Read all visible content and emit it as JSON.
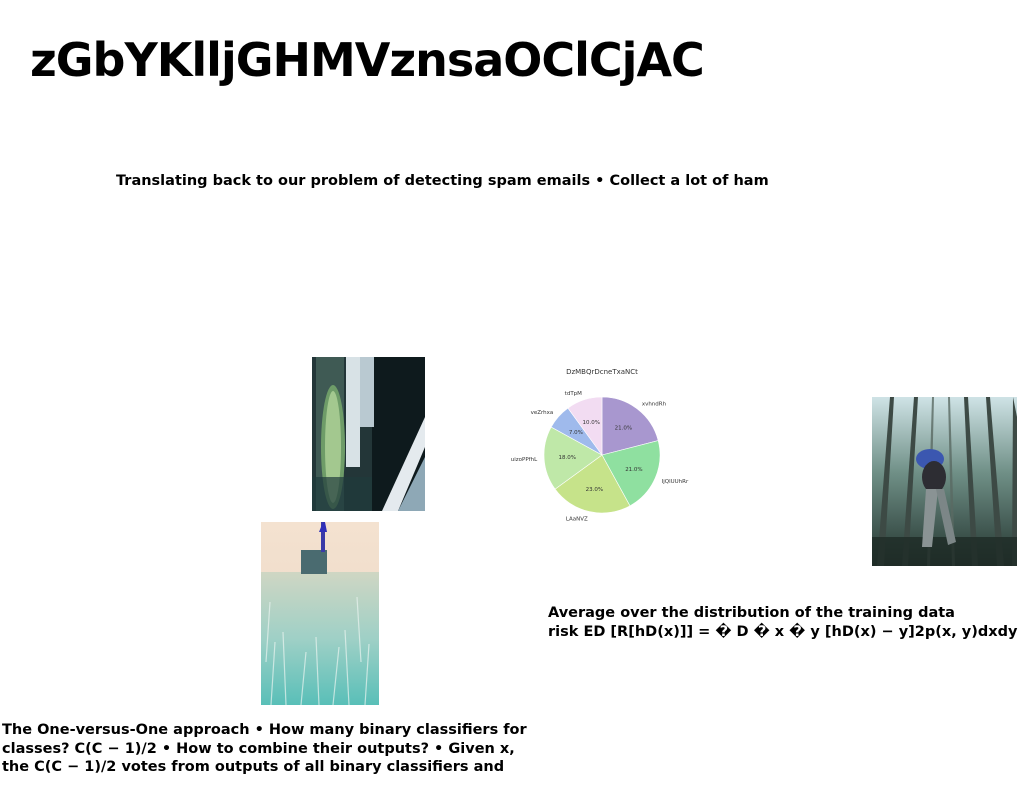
{
  "slide": {
    "title": "zGbYKlljGHMVznsaOClCjAC",
    "subtitle": "Translating back to our problem of detecting spam emails • Collect a lot of ham",
    "bottom_left_text": "The One-versus-One approach • How many binary classifiers for classes? C(C − 1)/2 • How to combine their outputs? • Given x, the C(C − 1)/2 votes from outputs of all binary classifiers and",
    "right_text_line1": "Average over the distribution of the training data",
    "right_text_line2": "risk ED [R[hD(x)]] = � D � x � y [hD(x) − y]2p(x, y)dxdy"
  },
  "chart_data": {
    "type": "pie",
    "title": "DzMBQrDcneTxaNCt",
    "labels": [
      "xvhndRh",
      "IjQlUUhRr",
      "LAaNVZ",
      "uizoPPfhL",
      "veZrhxa",
      "tdTpM"
    ],
    "values": [
      21.0,
      21.0,
      23.0,
      18.0,
      7.0,
      10.0
    ],
    "value_labels": [
      "21.0%",
      "21.0%",
      "23.0%",
      "18.0%",
      "7.0%",
      "10.0%"
    ],
    "colors": [
      "#a897cf",
      "#8fe0a0",
      "#c6e38a",
      "#bfe8a8",
      "#9fbaec",
      "#f2dcf2"
    ],
    "start_angle": 90,
    "direction": "clockwise"
  }
}
